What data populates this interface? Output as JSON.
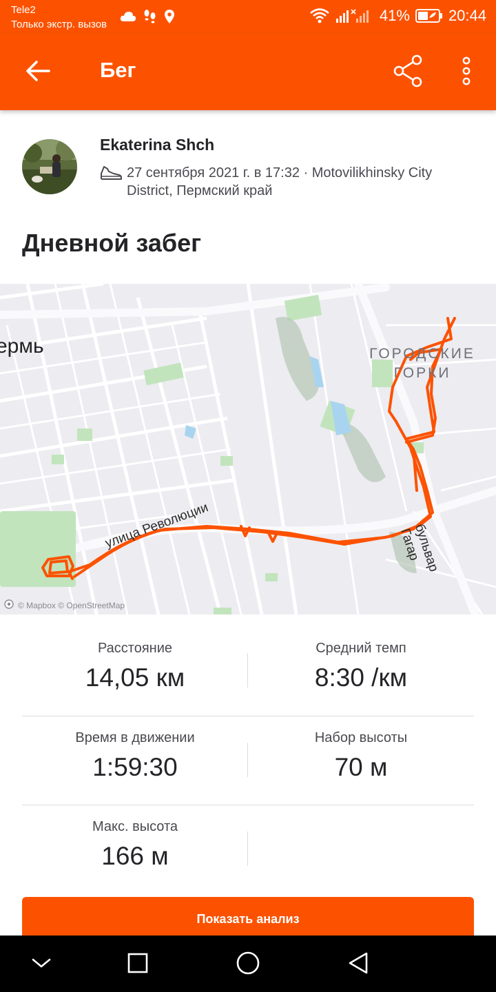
{
  "status_bar": {
    "carrier": "Tele2",
    "emergency": "Только экстр. вызов",
    "battery": "41%",
    "time": "20:44",
    "icons": [
      "cloud-icon",
      "steps-icon",
      "location-icon",
      "wifi-icon",
      "signal-icon",
      "battery-icon"
    ]
  },
  "app_bar": {
    "title": "Бег",
    "icons": [
      "back-arrow-icon",
      "share-icon",
      "more-vertical-icon"
    ]
  },
  "activity": {
    "athlete_name": "Ekaterina Shch",
    "meta": "27 сентября 2021 г. в 17:32 · Motovilikhinsky City District, Пермский край",
    "title": "Дневной забег",
    "sport_icon": "shoe-icon"
  },
  "map": {
    "city_label": "ермь",
    "district_label": "ГОРОДСКИЕ ГОРКИ",
    "street_1": "улица Революции",
    "street_2": "бульвар Гагар",
    "attribution": "© Mapbox © OpenStreetMap",
    "route_color": "#fc5200"
  },
  "stats": {
    "distance_label": "Расстояние",
    "distance_value": "14,05 км",
    "pace_label": "Средний темп",
    "pace_value": "8:30 /км",
    "moving_time_label": "Время в движении",
    "moving_time_value": "1:59:30",
    "elevation_gain_label": "Набор высоты",
    "elevation_gain_value": "70 м",
    "max_elevation_label": "Макс. высота",
    "max_elevation_value": "166 м"
  },
  "actions": {
    "show_analysis": "Показать анализ"
  },
  "colors": {
    "brand": "#fc5200",
    "text_primary": "#242428",
    "text_secondary": "#494950"
  }
}
